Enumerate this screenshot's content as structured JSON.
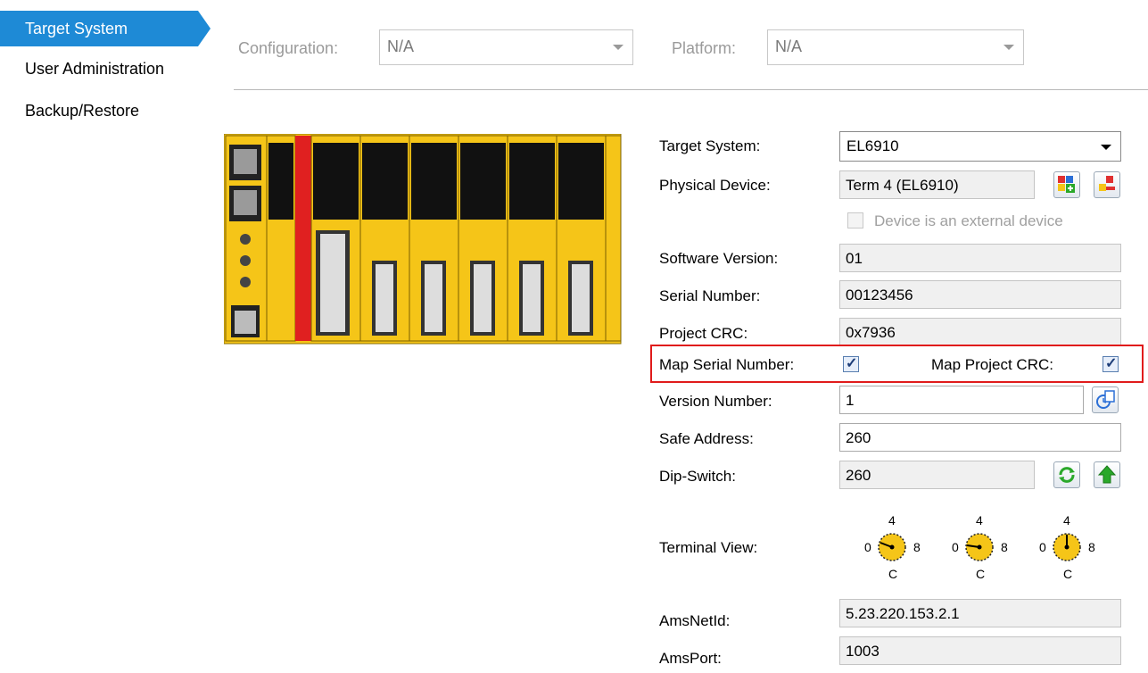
{
  "nav": {
    "items": [
      {
        "label": "Target System",
        "active": true
      },
      {
        "label": "User Administration",
        "active": false
      },
      {
        "label": "Backup/Restore",
        "active": false
      }
    ]
  },
  "toolbar": {
    "configuration_label": "Configuration:",
    "configuration_value": "N/A",
    "platform_label": "Platform:",
    "platform_value": "N/A"
  },
  "form": {
    "target_system_label": "Target System:",
    "target_system_value": "EL6910",
    "physical_device_label": "Physical Device:",
    "physical_device_value": "Term 4 (EL6910)",
    "external_device_label": "Device is an external device",
    "external_device_checked": false,
    "software_version_label": "Software Version:",
    "software_version_value": "01",
    "serial_number_label": "Serial Number:",
    "serial_number_value": "00123456",
    "project_crc_label": "Project CRC:",
    "project_crc_value": "0x7936",
    "map_serial_label": "Map Serial Number:",
    "map_serial_checked": true,
    "map_crc_label": "Map Project CRC:",
    "map_crc_checked": true,
    "version_number_label": "Version Number:",
    "version_number_value": "1",
    "safe_address_label": "Safe Address:",
    "safe_address_value": "260",
    "dip_switch_label": "Dip-Switch:",
    "dip_switch_value": "260",
    "terminal_view_label": "Terminal View:",
    "dials": [
      {
        "top": "4",
        "left": "0",
        "right": "8",
        "bottom": "C"
      },
      {
        "top": "4",
        "left": "0",
        "right": "8",
        "bottom": "C"
      },
      {
        "top": "4",
        "left": "0",
        "right": "8",
        "bottom": "C"
      }
    ],
    "ams_net_id_label": "AmsNetId:",
    "ams_net_id_value": "5.23.220.153.2.1",
    "ams_port_label": "AmsPort:",
    "ams_port_value": "1003"
  },
  "colors": {
    "accent": "#1e8ad6",
    "terminal_yellow": "#f5c518",
    "highlight_red": "#e01b1b"
  }
}
